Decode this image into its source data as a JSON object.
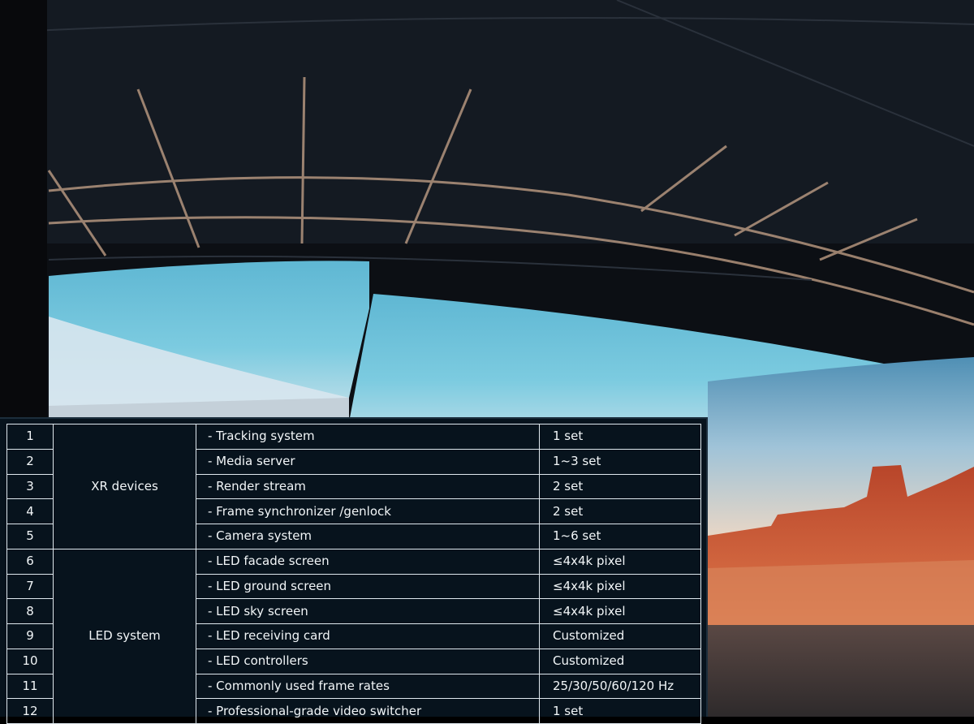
{
  "colors": {
    "panel_bg": "#07131d",
    "border": "#dfe8ee",
    "sky": "#6cc3dc",
    "rock": "#c24d2c"
  },
  "table": {
    "groups": [
      {
        "label": "XR devices",
        "rows": [
          {
            "num": "1",
            "item": "- Tracking system",
            "value": "1 set"
          },
          {
            "num": "2",
            "item": "- Media server",
            "value": "1~3 set"
          },
          {
            "num": "3",
            "item": "- Render stream",
            "value": "2 set"
          },
          {
            "num": "4",
            "item": "- Frame synchronizer /genlock",
            "value": "2 set"
          },
          {
            "num": "5",
            "item": "- Camera system",
            "value": "1~6 set"
          }
        ]
      },
      {
        "label": "LED system",
        "rows": [
          {
            "num": "6",
            "item": "- LED facade screen",
            "value": "≤4x4k pixel"
          },
          {
            "num": "7",
            "item": "- LED ground screen",
            "value": "≤4x4k pixel"
          },
          {
            "num": "8",
            "item": "- LED sky screen",
            "value": "≤4x4k pixel"
          },
          {
            "num": "9",
            "item": "- LED receiving card",
            "value": "Customized"
          },
          {
            "num": "10",
            "item": "- LED controllers",
            "value": "Customized"
          },
          {
            "num": "11",
            "item": "- Commonly used frame rates",
            "value": "25/30/50/60/120 Hz"
          },
          {
            "num": "12",
            "item": "- Professional-grade video switcher",
            "value": "1 set"
          }
        ]
      }
    ]
  }
}
